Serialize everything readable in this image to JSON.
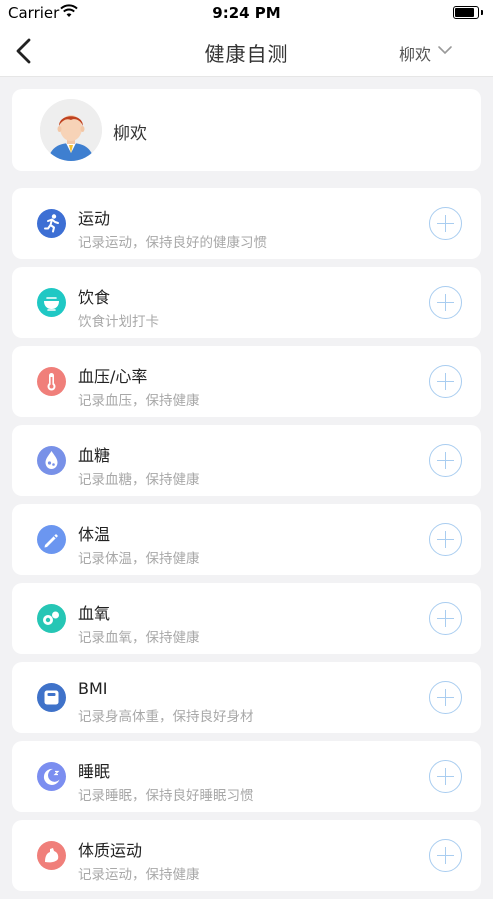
{
  "status_bar": {
    "carrier": "Carrier",
    "time": "9:24 PM"
  },
  "nav": {
    "title": "健康自测",
    "user_switch": "柳欢"
  },
  "user": {
    "name": "柳欢"
  },
  "items": [
    {
      "title": "运动",
      "subtitle": "记录运动，保持良好的健康习惯",
      "icon": "running-icon",
      "color": "#3d6fd4"
    },
    {
      "title": "饮食",
      "subtitle": "饮食计划打卡",
      "icon": "food-bowl-icon",
      "color": "#1fc8c4"
    },
    {
      "title": "血压/心率",
      "subtitle": "记录血压，保持健康",
      "icon": "thermometer-icon",
      "color": "#f07f7a"
    },
    {
      "title": "血糖",
      "subtitle": "记录血糖，保持健康",
      "icon": "blood-drop-icon",
      "color": "#7891e8"
    },
    {
      "title": "体温",
      "subtitle": "记录体温，保持健康",
      "icon": "temperature-stick-icon",
      "color": "#6b96f0"
    },
    {
      "title": "血氧",
      "subtitle": "记录血氧，保持健康",
      "icon": "oxygen-icon",
      "color": "#26c6b5"
    },
    {
      "title": "BMI",
      "subtitle": "记录身高体重，保持良好身材",
      "icon": "scale-icon",
      "color": "#3f72c9"
    },
    {
      "title": "睡眠",
      "subtitle": "记录睡眠，保持良好睡眠习惯",
      "icon": "moon-icon",
      "color": "#7b8ef0"
    },
    {
      "title": "体质运动",
      "subtitle": "记录运动，保持健康",
      "icon": "muscle-icon",
      "color": "#f07f7a"
    }
  ]
}
